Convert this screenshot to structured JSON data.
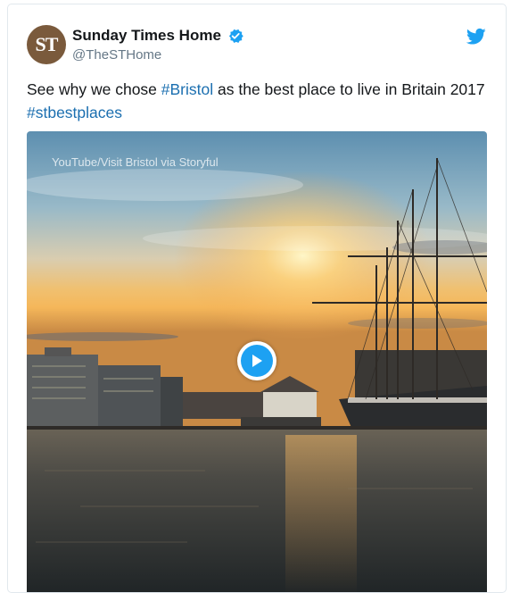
{
  "tweet": {
    "avatar_text": "ST",
    "display_name": "Sunday Times Home",
    "handle": "@TheSTHome",
    "text_before": "See why we chose ",
    "hashtag1": "#Bristol",
    "text_middle": " as the best place to live in Britain 2017 ",
    "hashtag2": "#stbestplaces"
  },
  "media": {
    "watermark": "YouTube/Visit Bristol via Storyful"
  },
  "icons": {
    "verified": "verified-badge-icon",
    "brand": "twitter-bird-icon",
    "play": "play-icon"
  },
  "colors": {
    "link": "#1b6fb0",
    "brand": "#1da1f2"
  }
}
